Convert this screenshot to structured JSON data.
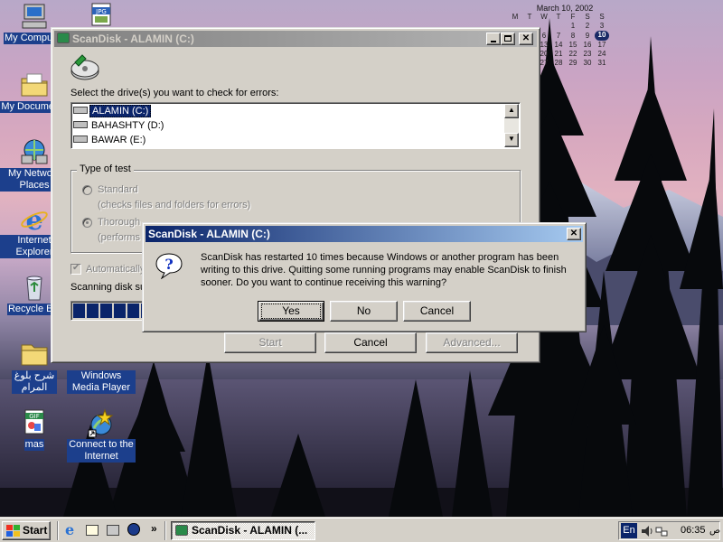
{
  "calendar": {
    "title": "March 10, 2002",
    "weekdays": [
      "M",
      "T",
      "W",
      "T",
      "F",
      "S",
      "S"
    ],
    "rows": [
      [
        "",
        "",
        "",
        "",
        "1",
        "2",
        "3"
      ],
      [
        "4",
        "5",
        "6",
        "7",
        "8",
        "9",
        "10"
      ],
      [
        "11",
        "12",
        "13",
        "14",
        "15",
        "16",
        "17"
      ],
      [
        "18",
        "19",
        "20",
        "21",
        "22",
        "23",
        "24"
      ],
      [
        "25",
        "26",
        "27",
        "28",
        "29",
        "30",
        "31"
      ]
    ],
    "today": "10"
  },
  "desktop_icons": {
    "my_computer": "My Computer",
    "my_documents": "My Documents",
    "my_network_places": "My Network Places",
    "internet_explorer": "Internet Explorer",
    "recycle_bin": "Recycle Bin",
    "arabic_folder": "شرح بلوغ المرام",
    "windows_media_player": "Windows Media Player",
    "mas": "mas",
    "connect_internet": "Connect to the Internet",
    "jpg_badge": "JPG",
    "gif_badge": "GIF"
  },
  "scandisk": {
    "title": "ScanDisk - ALAMIN (C:)",
    "select_label": "Select the drive(s) you want to check for errors:",
    "drives": [
      {
        "label": "ALAMIN (C:)",
        "selected": true
      },
      {
        "label": "BAHASHTY (D:)",
        "selected": false
      },
      {
        "label": "BAWAR (E:)",
        "selected": false
      }
    ],
    "type_of_test": "Type of test",
    "standard": "Standard",
    "standard_desc": "(checks files and folders for errors)",
    "thorough": "Thorough",
    "thorough_desc": "(performs",
    "automatically": "Automatically",
    "scanning": "Scanning disk su",
    "progress": 0.28,
    "start": "Start",
    "cancel": "Cancel",
    "advanced": "Advanced..."
  },
  "dialog": {
    "title": "ScanDisk - ALAMIN (C:)",
    "message": "ScanDisk has restarted 10 times because Windows or another program has been writing to this drive. Quitting some running programs may enable ScanDisk to finish sooner. Do you want to continue receiving this warning?",
    "yes": "Yes",
    "no": "No",
    "cancel": "Cancel",
    "icon": "question-icon"
  },
  "taskbar": {
    "start": "Start",
    "task": "ScanDisk - ALAMIN (...",
    "chevron": "»",
    "lang": "En",
    "time": "06:35",
    "time_suffix": "ص"
  },
  "colors": {
    "title_active": "#0a246a",
    "title_inactive": "#808080",
    "face": "#d4d0c8",
    "selection": "#0a246a",
    "progress": "#0a246a"
  }
}
